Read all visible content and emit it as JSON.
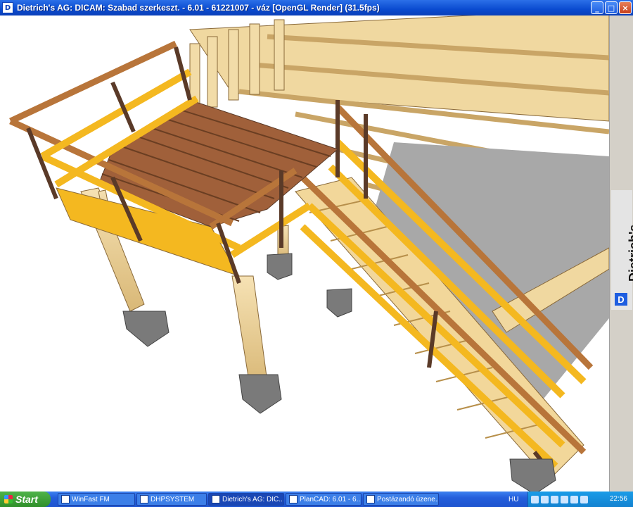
{
  "window": {
    "title": "Dietrich's AG: DICAM: Szabad szerkeszt. - 6.01 - 61221007 - váz [OpenGL Render] (31.5fps)",
    "app_icon": "D",
    "controls": {
      "minimize": "_",
      "maximize": "□",
      "close": "×"
    }
  },
  "side_panel": {
    "brand": "Dietrich's",
    "logo": "D"
  },
  "taskbar": {
    "start_label": "Start",
    "items": [
      {
        "label": "WinFast FM"
      },
      {
        "label": "DHPSYSTEM"
      },
      {
        "label": "Dietrich's AG: DIC..."
      },
      {
        "label": "PlanCAD: 6.01 - 6..."
      },
      {
        "label": "Postázandó üzene..."
      }
    ],
    "language": "HU",
    "clock": "22:56"
  },
  "colors": {
    "titlebar": "#0a4bd0",
    "lumber": "#f0d8a0",
    "deck": "#a0603a",
    "rail_dark": "#5a3a28",
    "board_yellow": "#f4b820",
    "concrete": "#7a7a7a"
  }
}
